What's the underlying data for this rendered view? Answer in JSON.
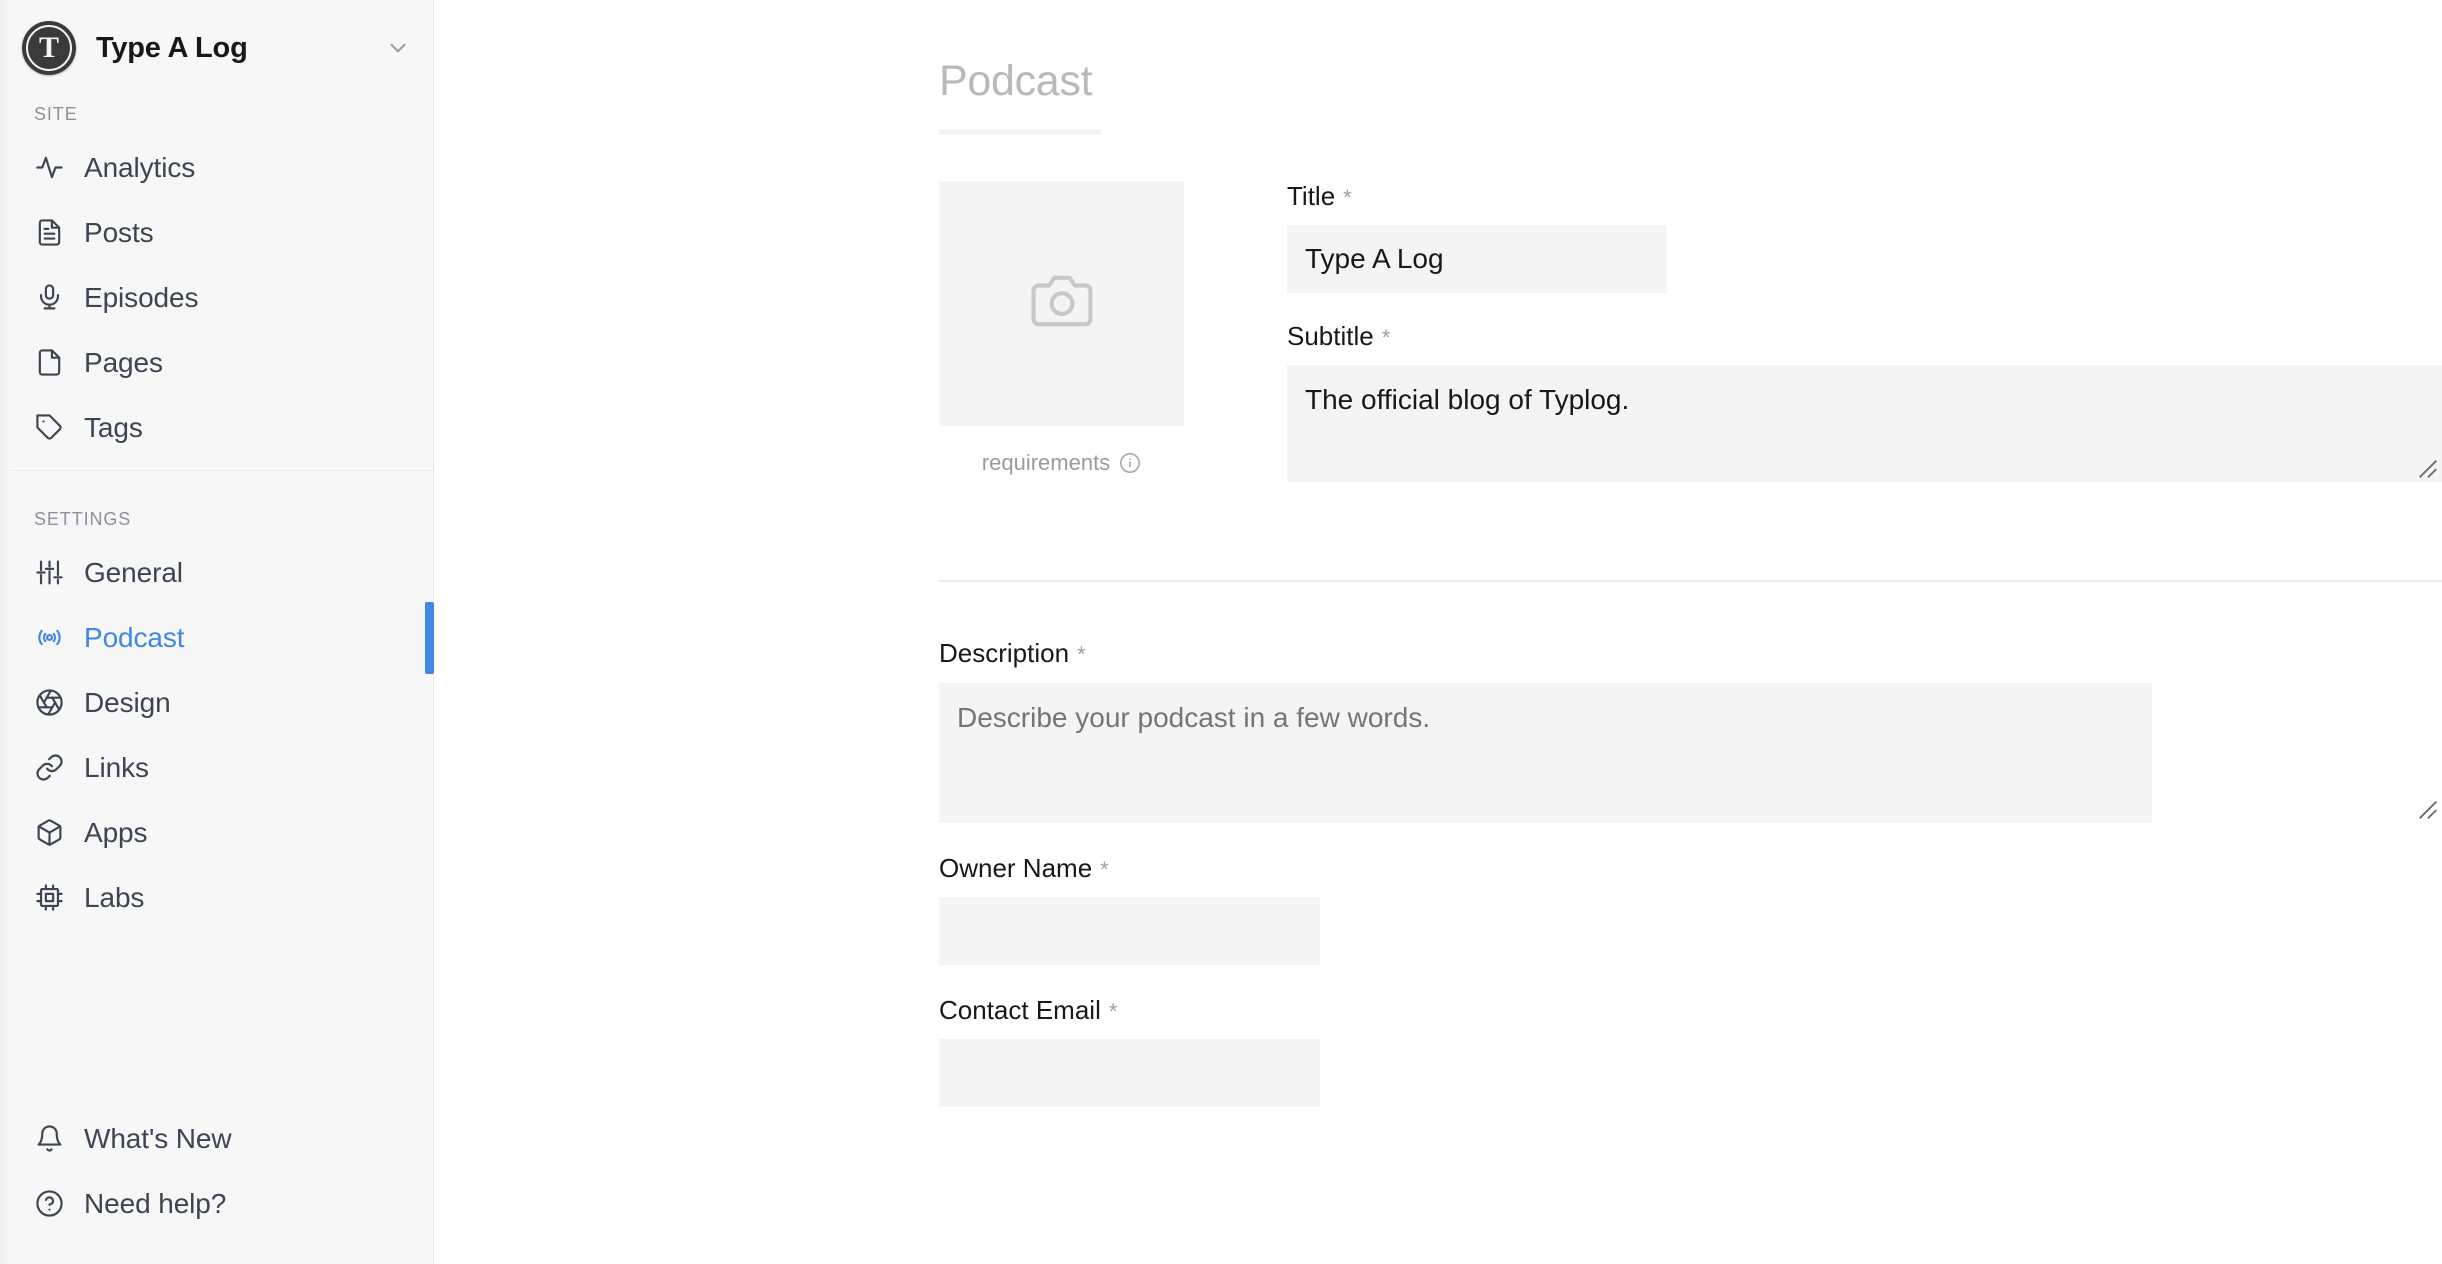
{
  "sidebar": {
    "brand": {
      "name": "Type A Log",
      "logo_letter": "T",
      "chevron_icon": "chevron-down-icon"
    },
    "groups": [
      {
        "label": "SITE",
        "items": [
          {
            "label": "Analytics",
            "icon": "activity-icon",
            "active": false
          },
          {
            "label": "Posts",
            "icon": "file-text-icon",
            "active": false
          },
          {
            "label": "Episodes",
            "icon": "microphone-icon",
            "active": false
          },
          {
            "label": "Pages",
            "icon": "file-icon",
            "active": false
          },
          {
            "label": "Tags",
            "icon": "tag-icon",
            "active": false
          }
        ]
      },
      {
        "label": "SETTINGS",
        "items": [
          {
            "label": "General",
            "icon": "sliders-icon",
            "active": false
          },
          {
            "label": "Podcast",
            "icon": "broadcast-icon",
            "active": true
          },
          {
            "label": "Design",
            "icon": "aperture-icon",
            "active": false
          },
          {
            "label": "Links",
            "icon": "link-icon",
            "active": false
          },
          {
            "label": "Apps",
            "icon": "package-icon",
            "active": false
          },
          {
            "label": "Labs",
            "icon": "cpu-icon",
            "active": false
          }
        ]
      }
    ],
    "footer_items": [
      {
        "label": "What's New",
        "icon": "bell-icon"
      },
      {
        "label": "Need help?",
        "icon": "help-circle-icon"
      }
    ],
    "accent_color": "#3f88e5",
    "background_color": "#f7f7f7"
  },
  "main": {
    "page_title": "Podcast",
    "cover": {
      "icon": "camera-icon",
      "caption": "requirements",
      "info_icon": "info-circle-icon"
    },
    "fields": {
      "title": {
        "label": "Title",
        "required_marker": "*",
        "value": "Type A Log",
        "placeholder": ""
      },
      "subtitle": {
        "label": "Subtitle",
        "required_marker": "*",
        "value": "The official blog of Typlog.",
        "placeholder": ""
      },
      "description": {
        "label": "Description",
        "required_marker": "*",
        "value": "",
        "placeholder": "Describe your podcast in a few words."
      },
      "owner_name": {
        "label": "Owner Name",
        "required_marker": "*",
        "value": "",
        "placeholder": ""
      },
      "contact_email": {
        "label": "Contact Email",
        "required_marker": "*",
        "value": "",
        "placeholder": ""
      }
    }
  }
}
